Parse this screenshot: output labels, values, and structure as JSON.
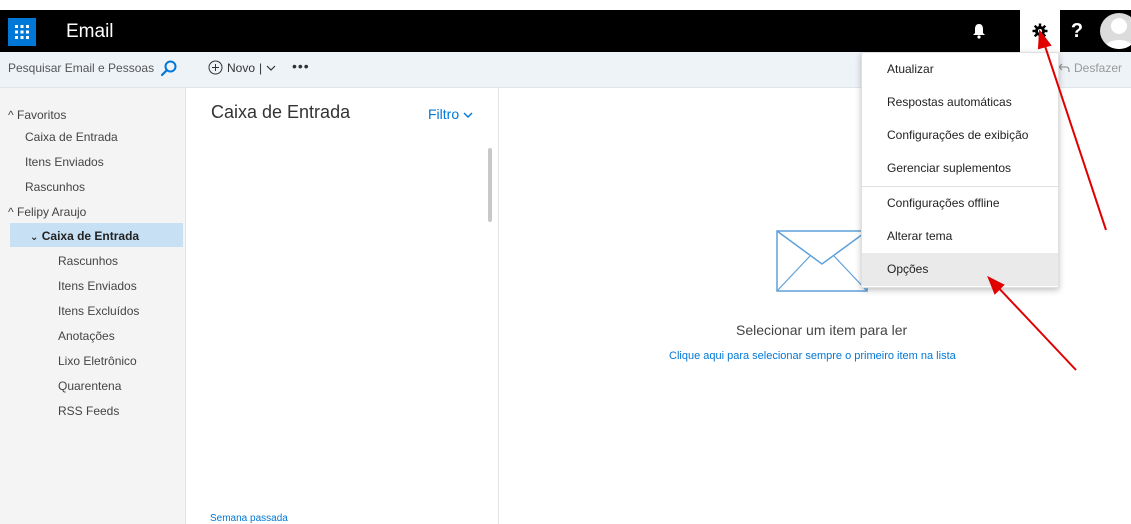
{
  "header": {
    "app_title": "Email",
    "help_label": "?"
  },
  "toolbar": {
    "search_placeholder": "Pesquisar Email e Pessoas",
    "new_label": "Novo",
    "new_separator": "|",
    "more_label": "•••",
    "undo_label": "Desfazer"
  },
  "sidebar": {
    "favorites_label": "Favoritos",
    "favorites": [
      "Caixa de Entrada",
      "Itens Enviados",
      "Rascunhos"
    ],
    "account_label": "Felipy Araujo",
    "selected_folder": "Caixa de Entrada",
    "folders": [
      "Rascunhos",
      "Itens Enviados",
      "Itens Excluídos",
      "Anotações",
      "Lixo Eletrônico",
      "Quarentena",
      "RSS Feeds"
    ]
  },
  "message_list": {
    "title": "Caixa de Entrada",
    "filter_label": "Filtro",
    "group_label": "Semana passada"
  },
  "reading_pane": {
    "empty_text": "Selecionar um item para ler",
    "link_text": "Clique aqui para selecionar sempre o primeiro item na lista"
  },
  "settings_menu": {
    "items": [
      "Atualizar",
      "Respostas automáticas",
      "Configurações de exibição",
      "Gerenciar suplementos",
      "Configurações offline",
      "Alterar tema",
      "Opções"
    ],
    "highlighted_index": 6
  },
  "colors": {
    "accent": "#0078d7",
    "topbar": "#000000",
    "annotation_arrow": "#e00000"
  },
  "icons": [
    "waffle-icon",
    "bell-icon",
    "gear-icon",
    "avatar-icon",
    "search-icon",
    "plus-circle-icon",
    "chevron-down-icon",
    "undo-icon",
    "envelope-icon"
  ]
}
